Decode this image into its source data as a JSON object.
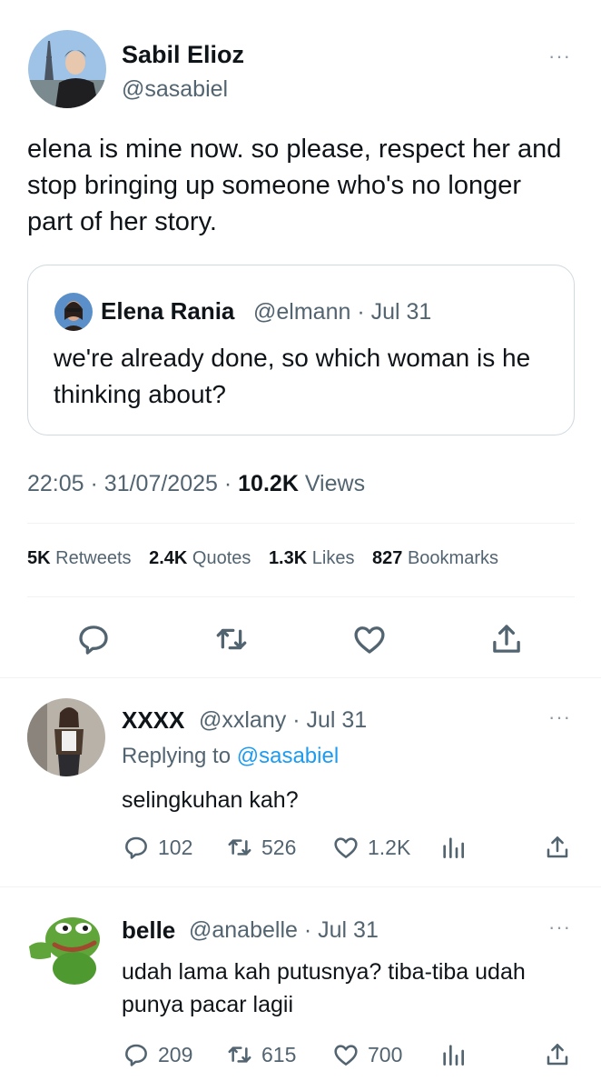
{
  "tweet": {
    "author_name": "Sabil Elioz",
    "author_handle": "@sasabiel",
    "more_label": "···",
    "text": "elena is mine now. so please, respect her and stop bringing up someone who's no longer part of her story.",
    "quote": {
      "author_name": "Elena Rania",
      "author_handle": "@elmann",
      "date": "Jul 31",
      "text": "we're already done, so which woman is he thinking about?"
    },
    "time": "22:05",
    "date": "31/07/2025",
    "views_count": "10.2K",
    "views_label": "Views",
    "stats": {
      "retweets_count": "5K",
      "retweets_label": "Retweets",
      "quotes_count": "2.4K",
      "quotes_label": "Quotes",
      "likes_count": "1.3K",
      "likes_label": "Likes",
      "bookmarks_count": "827",
      "bookmarks_label": "Bookmarks"
    },
    "actions": [
      "reply-icon",
      "retweet-icon",
      "like-icon",
      "share-icon"
    ]
  },
  "replies": [
    {
      "author_name": "XXXX",
      "author_handle": "@xxlany",
      "date": "Jul 31",
      "replying_prefix": "Replying to ",
      "replying_to": "@sasabiel",
      "text": "selingkuhan kah?",
      "reply_count": "102",
      "retweet_count": "526",
      "like_count": "1.2K"
    },
    {
      "author_name": "belle",
      "author_handle": "@anabelle",
      "date": "Jul 31",
      "text": "udah lama kah putusnya? tiba-tiba udah punya pacar lagii",
      "reply_count": "209",
      "retweet_count": "615",
      "like_count": "700"
    }
  ],
  "colors": {
    "text": "#0f1419",
    "secondary": "#536471",
    "link": "#1d9bf0",
    "border": "#cfd9de"
  }
}
